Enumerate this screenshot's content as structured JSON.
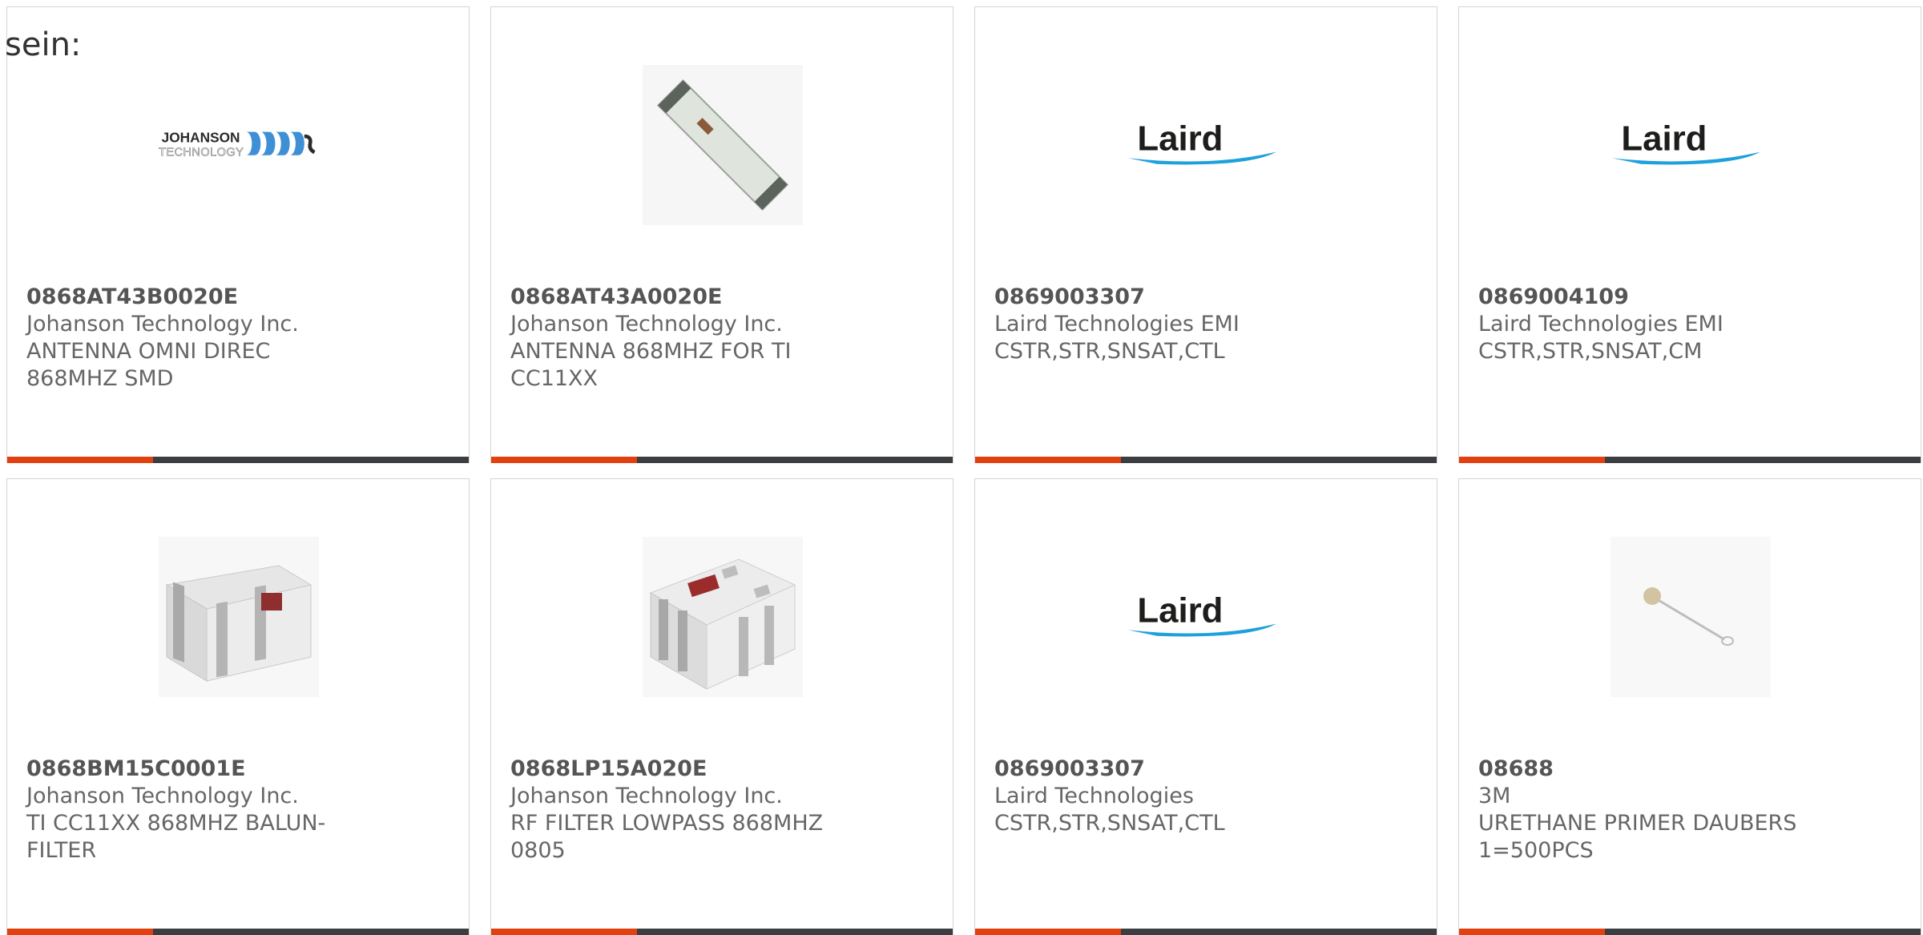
{
  "intro_text": "sein:",
  "products": [
    {
      "part_number": "0868AT43B0020E",
      "manufacturer": "Johanson Technology Inc.",
      "description": "ANTENNA OMNI DIREC 868MHZ SMD",
      "image": "johanson-logo"
    },
    {
      "part_number": "0868AT43A0020E",
      "manufacturer": "Johanson Technology Inc.",
      "description": "ANTENNA 868MHZ FOR TI CC11XX",
      "image": "chip-antenna-photo"
    },
    {
      "part_number": "0869003307",
      "manufacturer": "Laird Technologies EMI",
      "description": "CSTR,STR,SNSAT,CTL",
      "image": "laird-logo"
    },
    {
      "part_number": "0869004109",
      "manufacturer": "Laird Technologies EMI",
      "description": "CSTR,STR,SNSAT,CM",
      "image": "laird-logo"
    },
    {
      "part_number": "0868BM15C0001E",
      "manufacturer": "Johanson Technology Inc.",
      "description": "TI CC11XX 868MHZ BALUN-FILTER",
      "image": "balun-filter-photo"
    },
    {
      "part_number": "0868LP15A020E",
      "manufacturer": "Johanson Technology Inc.",
      "description": "RF FILTER LOWPASS 868MHZ 0805",
      "image": "lowpass-filter-photo"
    },
    {
      "part_number": "0869003307",
      "manufacturer": "Laird Technologies",
      "description": "CSTR,STR,SNSAT,CTL",
      "image": "laird-logo"
    },
    {
      "part_number": "08688",
      "manufacturer": "3M",
      "description": "URETHANE PRIMER DAUBERS 1=500PCS",
      "image": "dauber-photo"
    }
  ],
  "logo_text": {
    "johanson_line1": "JOHANSON",
    "johanson_line2": "TECHNOLOGY",
    "laird": "Laird"
  },
  "colors": {
    "accent": "#e2400f",
    "bar": "#3b3d40",
    "border": "#d4d4d4",
    "text": "#666666",
    "laird_blue": "#1ea0dc"
  }
}
